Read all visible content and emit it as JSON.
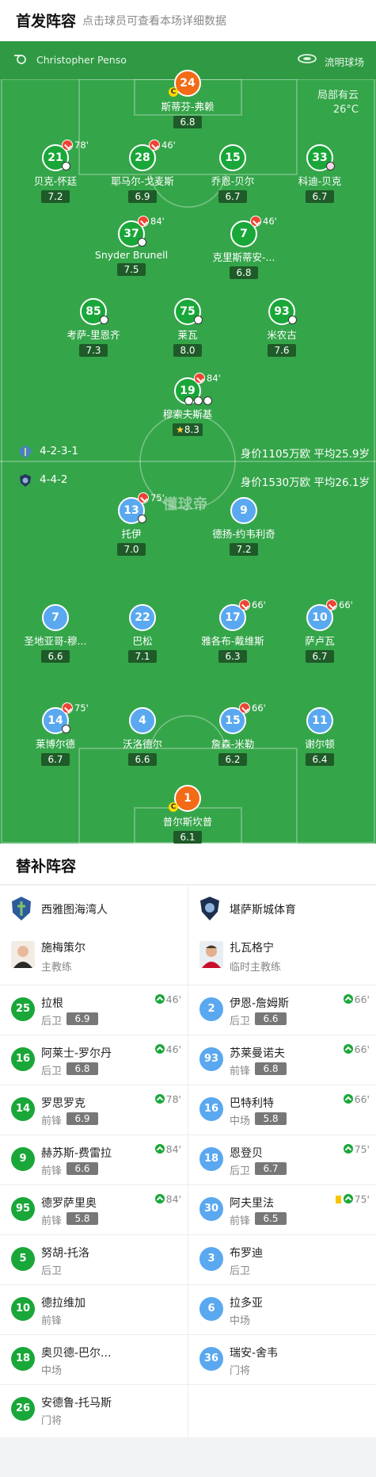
{
  "header": {
    "title": "首发阵容",
    "subtitle": "点击球员可查看本场详细数据"
  },
  "match": {
    "referee": "Christopher Penso",
    "venue": "流明球场",
    "weather": "局部有云",
    "temperature": "26°C",
    "watermark": "懂球帝"
  },
  "home": {
    "formation": "4-2-3-1",
    "value": "身价1105万欧 平均25.9岁",
    "players": [
      {
        "num": "24",
        "name": "斯蒂芬-弗赖",
        "rating": "6.8"
      },
      {
        "num": "21",
        "name": "贝克-怀廷",
        "rating": "7.2",
        "sub": "78'"
      },
      {
        "num": "28",
        "name": "耶马尔-戈麦斯",
        "rating": "6.9",
        "sub": "46'"
      },
      {
        "num": "15",
        "name": "乔恩-贝尔",
        "rating": "6.7"
      },
      {
        "num": "33",
        "name": "科迪-贝克",
        "rating": "6.7"
      },
      {
        "num": "37",
        "name": "Snyder Brunell",
        "rating": "7.5",
        "sub": "84'"
      },
      {
        "num": "7",
        "name": "克里斯蒂安-...",
        "rating": "6.8",
        "sub": "46'"
      },
      {
        "num": "85",
        "name": "考萨-里恩齐",
        "rating": "7.3"
      },
      {
        "num": "75",
        "name": "莱瓦",
        "rating": "8.0"
      },
      {
        "num": "93",
        "name": "米农古",
        "rating": "7.6"
      },
      {
        "num": "19",
        "name": "穆索夫斯基",
        "rating": "8.3",
        "sub": "84'"
      }
    ]
  },
  "away": {
    "formation": "4-4-2",
    "value": "身价1530万欧 平均26.1岁",
    "players": [
      {
        "num": "13",
        "name": "托伊",
        "rating": "7.0",
        "sub": "75'"
      },
      {
        "num": "9",
        "name": "德扬-约韦利奇",
        "rating": "7.2"
      },
      {
        "num": "7",
        "name": "圣地亚哥-穆...",
        "rating": "6.6"
      },
      {
        "num": "22",
        "name": "巴松",
        "rating": "7.1"
      },
      {
        "num": "17",
        "name": "雅各布-戴维斯",
        "rating": "6.3",
        "sub": "66'"
      },
      {
        "num": "10",
        "name": "萨卢瓦",
        "rating": "6.7",
        "sub": "66'"
      },
      {
        "num": "14",
        "name": "莱博尔德",
        "rating": "6.7",
        "sub": "75'"
      },
      {
        "num": "4",
        "name": "沃洛德尔",
        "rating": "6.6"
      },
      {
        "num": "15",
        "name": "詹森-米勒",
        "rating": "6.2",
        "sub": "66'"
      },
      {
        "num": "11",
        "name": "谢尔顿",
        "rating": "6.4"
      },
      {
        "num": "1",
        "name": "普尔斯坎普",
        "rating": "6.1"
      }
    ]
  },
  "bench": {
    "title": "替补阵容",
    "home_team": "西雅图海湾人",
    "away_team": "堪萨斯城体育",
    "home_coach": {
      "name": "施梅策尔",
      "role": "主教练"
    },
    "away_coach": {
      "name": "扎瓦格宁",
      "role": "临时主教练"
    },
    "home_subs": [
      {
        "num": "25",
        "name": "拉根",
        "pos": "后卫",
        "rating": "6.9",
        "in": "46'"
      },
      {
        "num": "16",
        "name": "阿莱士-罗尔丹",
        "pos": "后卫",
        "rating": "6.8",
        "in": "46'"
      },
      {
        "num": "14",
        "name": "罗思罗克",
        "pos": "前锋",
        "rating": "6.9",
        "in": "78'"
      },
      {
        "num": "9",
        "name": "赫苏斯-费雷拉",
        "pos": "前锋",
        "rating": "6.6",
        "in": "84'"
      },
      {
        "num": "95",
        "name": "德罗萨里奥",
        "pos": "前锋",
        "rating": "5.8",
        "in": "84'"
      },
      {
        "num": "5",
        "name": "努胡-托洛",
        "pos": "后卫"
      },
      {
        "num": "10",
        "name": "德拉维加",
        "pos": "前锋"
      },
      {
        "num": "18",
        "name": "奥贝德-巴尔...",
        "pos": "中场"
      },
      {
        "num": "26",
        "name": "安德鲁-托马斯",
        "pos": "门将"
      }
    ],
    "away_subs": [
      {
        "num": "2",
        "name": "伊恩-詹姆斯",
        "pos": "后卫",
        "rating": "6.6",
        "in": "66'"
      },
      {
        "num": "93",
        "name": "苏莱曼诺夫",
        "pos": "前锋",
        "rating": "6.8",
        "in": "66'"
      },
      {
        "num": "16",
        "name": "巴特利特",
        "pos": "中场",
        "rating": "5.8",
        "in": "66'"
      },
      {
        "num": "18",
        "name": "恩登贝",
        "pos": "后卫",
        "rating": "6.7",
        "in": "75'"
      },
      {
        "num": "30",
        "name": "阿夫里法",
        "pos": "前锋",
        "rating": "6.5",
        "in": "75'"
      },
      {
        "num": "3",
        "name": "布罗迪",
        "pos": "后卫"
      },
      {
        "num": "6",
        "name": "拉多亚",
        "pos": "中场"
      },
      {
        "num": "36",
        "name": "瑞安-舍韦",
        "pos": "门将"
      }
    ]
  },
  "colors": {
    "pitch": "#35a54a",
    "home": "#1aa739",
    "away": "#5aa8f0",
    "goalkeeper": "#f36b16"
  }
}
